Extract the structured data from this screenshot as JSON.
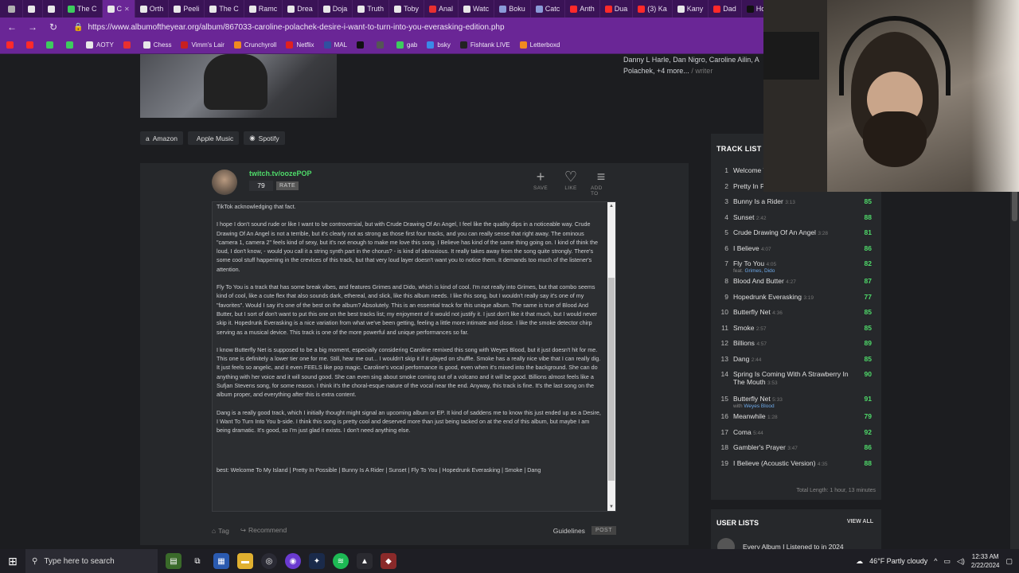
{
  "browser": {
    "tabs": [
      {
        "label": "",
        "color": "#b0b0b0"
      },
      {
        "label": "",
        "color": "#e8e8e8"
      },
      {
        "label": "",
        "color": "#e8e8e8"
      },
      {
        "label": "The C",
        "color": "#3dcc5e"
      },
      {
        "label": "C",
        "color": "#e8e8e8",
        "active": true
      },
      {
        "label": "Orth",
        "color": "#e8e8e8"
      },
      {
        "label": "Peeli",
        "color": "#e8e8e8"
      },
      {
        "label": "The C",
        "color": "#e8e8e8"
      },
      {
        "label": "Ramc",
        "color": "#e8e8e8"
      },
      {
        "label": "Drea",
        "color": "#e8e8e8"
      },
      {
        "label": "Doja",
        "color": "#e8e8e8"
      },
      {
        "label": "Truth",
        "color": "#e8e8e8"
      },
      {
        "label": "Toby",
        "color": "#e8e8e8"
      },
      {
        "label": "Anal",
        "color": "#e83030"
      },
      {
        "label": "Watc",
        "color": "#e8e8e8"
      },
      {
        "label": "Boku",
        "color": "#8a9ad8"
      },
      {
        "label": "Catc",
        "color": "#8a9ad8"
      },
      {
        "label": "Anth",
        "color": "#ff2a2a"
      },
      {
        "label": "Dua",
        "color": "#ff2a2a"
      },
      {
        "label": "(3) Ka",
        "color": "#ff2a2a"
      },
      {
        "label": "Kany",
        "color": "#e8e8e8"
      },
      {
        "label": "Dad",
        "color": "#ff2a2a"
      },
      {
        "label": "Hom",
        "color": "#111"
      }
    ],
    "url": "https://www.albumoftheyear.org/album/867033-caroline-polachek-desire-i-want-to-turn-into-you-everasking-edition.php",
    "bookmarks": [
      {
        "label": "",
        "color": "#ff2a2a"
      },
      {
        "label": "",
        "color": "#ff2a2a"
      },
      {
        "label": "",
        "color": "#3dcc5e"
      },
      {
        "label": "",
        "color": "#3dcc5e"
      },
      {
        "label": "AOTY",
        "color": "#e8e8e8"
      },
      {
        "label": "",
        "color": "#e83030"
      },
      {
        "label": "Chess",
        "color": "#e8e8e8"
      },
      {
        "label": "Vimm's Lair",
        "color": "#c82020"
      },
      {
        "label": "Crunchyroll",
        "color": "#f08a20"
      },
      {
        "label": "Netflix",
        "color": "#e02020"
      },
      {
        "label": "MAL",
        "color": "#3050a0"
      },
      {
        "label": "",
        "color": "#111"
      },
      {
        "label": "",
        "color": "#555"
      },
      {
        "label": "gab",
        "color": "#3dcc5e"
      },
      {
        "label": "bsky",
        "color": "#3a8ae8"
      },
      {
        "label": "Fishtank LIVE",
        "color": "#222"
      },
      {
        "label": "Letterboxd",
        "color": "#f08a20"
      }
    ]
  },
  "album": {
    "credits": "Danny L Harle, Dan Nigro, Caroline Ailin, A",
    "credits2": "Polachek, +4 more...",
    "credits_role": "/ writer",
    "store_links": [
      "Amazon",
      "Apple Music",
      "Spotify"
    ]
  },
  "review": {
    "reviewer": "twitch.tv/oozePOP",
    "score": "79",
    "rate_label": "RATE",
    "actions": [
      {
        "icon": "plus-icon",
        "glyph": "+",
        "label": "SAVE"
      },
      {
        "icon": "heart-icon",
        "glyph": "♡",
        "label": "LIKE"
      },
      {
        "icon": "list-icon",
        "glyph": "≡",
        "label": "ADD TO"
      }
    ],
    "paragraphs": [
      "TikTok acknowledging that fact.",
      "I hope I don't sound rude or like I want to be controversial, but with Crude Drawing Of An Angel, I feel like the quality dips in a noticeable way. Crude Drawing Of An Angel is not a terrible, but it's clearly not as strong as those first four tracks, and you can really sense that right away. The ominous \"camera 1, camera 2\" feels kind of sexy, but it's not enough to make me love this song. I Believe has kind of the same thing going on. I kind of think the loud, I don't know, - would you call it a string synth part in the chorus? - is kind of obnoxious. It really takes away from the song quite strongly. There's some cool stuff happening in the crevices of this track, but that very loud layer doesn't want you to notice them. It demands too much of the listener's attention.",
      "Fly To You is a track that has some break vibes, and features Grimes and Dido, which is kind of cool. I'm not really into Grimes, but that combo seems kind of cool, like a cute flex that also sounds dark, ethereal, and slick, like this album needs. I like this song, but I wouldn't really say it's one of my \"favorites\". Would I say it's one of the best on the album? Absolutely. This is an essential track for this unique album. The same is true of Blood And Butter, but I sort of don't want to put this one on the best tracks list; my enjoyment of it would not justify it. I just don't like it that much, but I would never skip it. Hopedrunk Everasking is a nice variation from what we've been getting, feeling a little more intimate and close. I like the smoke detector chirp serving as a musical device. This track is one of the more powerful and unique performances so far.",
      "I know Butterfly Net is supposed to be a big moment, especially considering Caroline remixed this song with Weyes Blood, but it just doesn't hit for me. This one is definitely a lower tier one for me. Still, hear me out... I wouldn't skip it if it played on shuffle. Smoke has a really nice vibe that I can really dig. It just feels so angelic, and it even FEELS like pop magic. Caroline's vocal performance is good, even when it's mixed into the background. She can do anything with her voice and it will sound good. She can even sing about smoke coming out of a volcano and it will be good. Billions almost feels like a Sufjan Stevens song, for some reason. I think it's the choral-esque nature of the vocal near the end. Anyway, this track is fine. It's the last song on the album proper, and everything after this is extra content.",
      "Dang is a really good track, which I initially thought might signal an upcoming album or EP. It kind of saddens me to know this just ended up as a Desire, I Want To Turn Into You b-side. I think this song is pretty cool and deserved more than just being tacked on at the end of this album, but maybe I am being dramatic. It's good, so I'm just glad it exists. I don't need anything else."
    ],
    "best": "best: Welcome To My Island | Pretty In Possible | Bunny Is A Rider | Sunset | Fly To You | Hopedrunk Everasking | Smoke | Dang",
    "tag_label": "Tag",
    "recommend_label": "Recommend",
    "guidelines_label": "Guidelines",
    "post_label": "POST"
  },
  "tracklist": {
    "heading": "TRACK LIST",
    "tracks": [
      {
        "num": "1",
        "title": "Welcome T",
        "len": "",
        "rating": "",
        "feat": ""
      },
      {
        "num": "2",
        "title": "Pretty In Po",
        "len": "",
        "rating": "",
        "feat": ""
      },
      {
        "num": "3",
        "title": "Bunny Is a Rider",
        "len": "3:13",
        "rating": "85",
        "feat": ""
      },
      {
        "num": "4",
        "title": "Sunset",
        "len": "2:42",
        "rating": "88",
        "feat": ""
      },
      {
        "num": "5",
        "title": "Crude Drawing Of An Angel",
        "len": "3:28",
        "rating": "81",
        "feat": ""
      },
      {
        "num": "6",
        "title": "I Believe",
        "len": "4:07",
        "rating": "86",
        "feat": ""
      },
      {
        "num": "7",
        "title": "Fly To You",
        "len": "4:05",
        "rating": "82",
        "feat": "feat. ",
        "feat_link": "Grimes, Dido"
      },
      {
        "num": "8",
        "title": "Blood And Butter",
        "len": "4:27",
        "rating": "87",
        "feat": ""
      },
      {
        "num": "9",
        "title": "Hopedrunk Everasking",
        "len": "3:19",
        "rating": "77",
        "feat": ""
      },
      {
        "num": "10",
        "title": "Butterfly Net",
        "len": "4:36",
        "rating": "85",
        "feat": ""
      },
      {
        "num": "11",
        "title": "Smoke",
        "len": "2:57",
        "rating": "85",
        "feat": ""
      },
      {
        "num": "12",
        "title": "Billions",
        "len": "4:57",
        "rating": "89",
        "feat": ""
      },
      {
        "num": "13",
        "title": "Dang",
        "len": "2:44",
        "rating": "85",
        "feat": ""
      },
      {
        "num": "14",
        "title": "Spring Is Coming With A Strawberry In The Mouth",
        "len": "3:53",
        "rating": "90",
        "feat": ""
      },
      {
        "num": "15",
        "title": "Butterfly Net",
        "len": "5:33",
        "rating": "91",
        "feat": "with ",
        "feat_link": "Weyes Blood"
      },
      {
        "num": "16",
        "title": "Meanwhile",
        "len": "1:28",
        "rating": "79",
        "feat": ""
      },
      {
        "num": "17",
        "title": "Coma",
        "len": "5:44",
        "rating": "92",
        "feat": ""
      },
      {
        "num": "18",
        "title": "Gambler's Prayer",
        "len": "3:47",
        "rating": "86",
        "feat": ""
      },
      {
        "num": "19",
        "title": "I Believe (Acoustic Version)",
        "len": "4:35",
        "rating": "88",
        "feat": ""
      }
    ],
    "total": "Total Length: 1 hour, 13 minutes"
  },
  "user_lists": {
    "heading": "USER LISTS",
    "view_all": "VIEW ALL",
    "item": "Every Album I Listened to in 2024"
  },
  "taskbar": {
    "search_placeholder": "Type here to search",
    "weather": "46°F  Partly cloudy",
    "time": "12:33 AM",
    "date": "2/22/2024"
  }
}
